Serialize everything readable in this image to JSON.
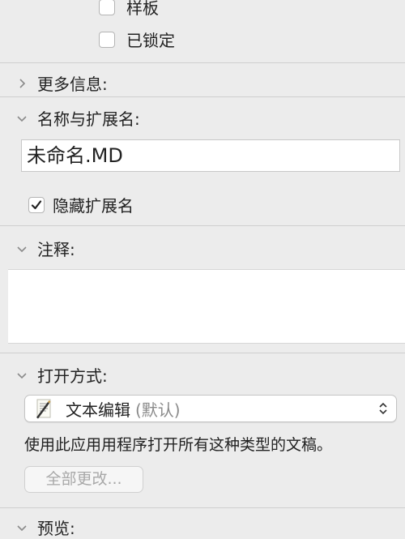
{
  "checkboxes": {
    "stationery": {
      "label": "样板",
      "checked": false
    },
    "locked": {
      "label": "已锁定",
      "checked": false
    }
  },
  "sections": {
    "more_info": {
      "title": "更多信息:",
      "expanded": false
    },
    "name_extension": {
      "title": "名称与扩展名:",
      "expanded": true
    },
    "comments": {
      "title": "注释:",
      "expanded": true
    },
    "open_with": {
      "title": "打开方式:",
      "expanded": true
    },
    "preview": {
      "title": "预览:",
      "expanded": true
    }
  },
  "name_field": {
    "value": "未命名.MD"
  },
  "hide_extension": {
    "label": "隐藏扩展名",
    "checked": true
  },
  "comments": {
    "value": ""
  },
  "open_with": {
    "app_icon": "textedit-icon",
    "app_name": "文本编辑",
    "app_default": "(默认)",
    "description": "使用此应用用程序打开所有这种类型的文稿。",
    "change_all_label": "全部更改..."
  }
}
